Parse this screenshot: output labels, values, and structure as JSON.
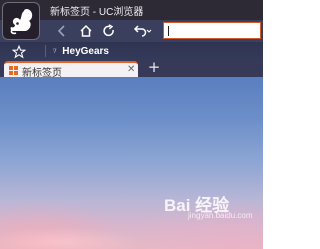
{
  "window": {
    "title": "新标签页 - UC浏览器"
  },
  "bookmarks": {
    "items": [
      {
        "label": "HeyGears",
        "icon": "heygears-favicon"
      }
    ]
  },
  "tabs": [
    {
      "label": "新标签页",
      "icon": "uc-newtab-icon",
      "active": true
    }
  ],
  "new_tab_label": "+",
  "address_bar": {
    "value": ""
  },
  "watermark": {
    "text": "Bai 经验",
    "sub": "jingyan.baidu.com"
  },
  "colors": {
    "accent": "#e0612a",
    "titlebar": "#2d2a35",
    "toolbar": "#3b3f5e"
  }
}
